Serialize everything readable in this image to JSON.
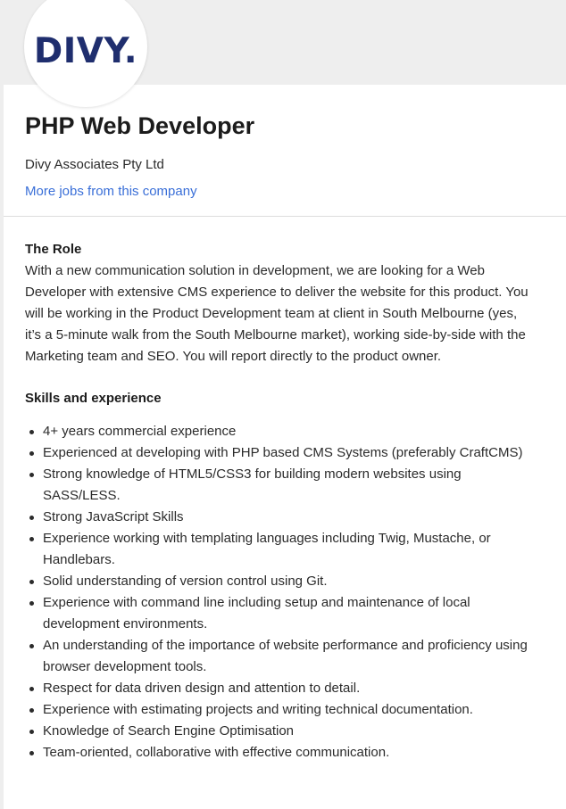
{
  "logo": {
    "text": "DIVY.",
    "color": "#1f2e6e"
  },
  "job": {
    "title": "PHP Web Developer",
    "company": "Divy Associates Pty Ltd",
    "more_jobs_link": "More jobs from this company",
    "link_color": "#3a6fd8"
  },
  "role": {
    "heading": "The Role",
    "text": "With a new communication solution in development, we are looking for a Web Developer with extensive CMS experience to deliver the website for this product. You will be working in the Product Development team at client in South Melbourne (yes, it’s a 5-minute walk from the South Melbourne market), working side-by-side with the Marketing team and SEO. You will report directly to the product owner."
  },
  "skills": {
    "heading": "Skills and experience",
    "items": [
      "4+ years commercial experience",
      "Experienced at developing with PHP based CMS Systems (preferably CraftCMS)",
      "Strong knowledge of HTML5/CSS3 for building modern websites using SASS/LESS.",
      "Strong JavaScript Skills",
      "Experience working with templating languages including Twig, Mustache, or Handlebars.",
      "Solid understanding of version control using Git.",
      "Experience with command line including setup and maintenance of local development environments.",
      "An understanding of the importance of website performance and proficiency using browser development tools.",
      "Respect for data driven design and attention to detail.",
      "Experience with estimating projects and writing technical documentation.",
      "Knowledge of Search Engine Optimisation",
      "Team-oriented, collaborative with effective communication."
    ]
  }
}
